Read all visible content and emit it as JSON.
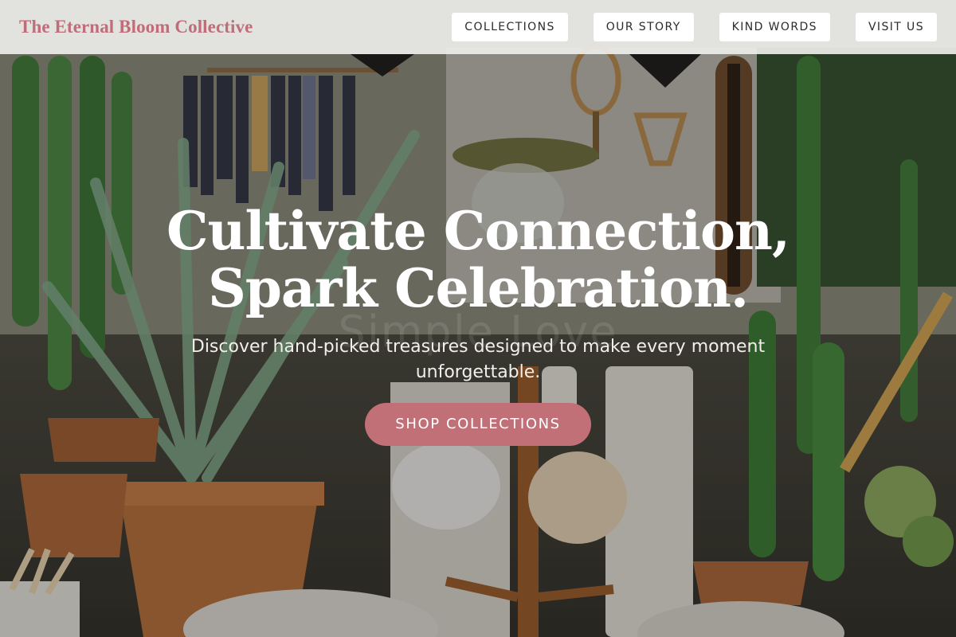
{
  "brand": {
    "name": "The Eternal Bloom Collective",
    "color": "#bf6d79"
  },
  "nav": {
    "items": [
      {
        "label": "COLLECTIONS"
      },
      {
        "label": "OUR STORY"
      },
      {
        "label": "KIND WORDS"
      },
      {
        "label": "VISIT US"
      }
    ]
  },
  "hero": {
    "headline_line1": "Cultivate Connection,",
    "headline_line2": "Spark Celebration.",
    "tagline": "Discover hand-picked treasures designed to make every moment unforgettable.",
    "cta_label": "SHOP COLLECTIONS",
    "cta_color": "#c27078",
    "watermark": "Simple Love",
    "image": "shop-interior-photo"
  }
}
